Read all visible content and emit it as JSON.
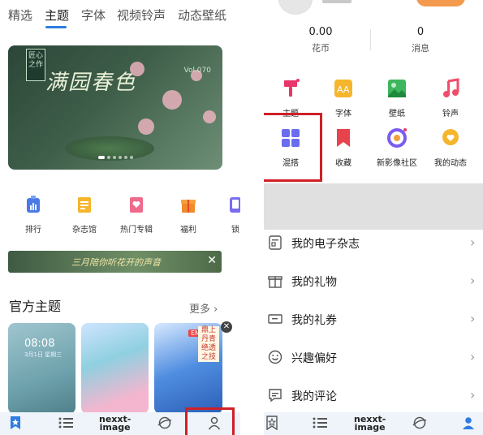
{
  "left": {
    "tabs": [
      {
        "label": "精选"
      },
      {
        "label": "主题"
      },
      {
        "label": "字体"
      },
      {
        "label": "视频铃声"
      },
      {
        "label": "动态壁纸"
      }
    ],
    "active_tab": "主题",
    "banner": {
      "title": "满园春色",
      "badge": "匠心之作",
      "vol": "Vol.070",
      "pages": 6,
      "current_page": 1
    },
    "shortcuts": [
      {
        "label": "排行",
        "icon": "ranking-icon"
      },
      {
        "label": "杂志馆",
        "icon": "magazine-icon"
      },
      {
        "label": "热门专辑",
        "icon": "album-icon"
      },
      {
        "label": "福利",
        "icon": "gift-icon"
      },
      {
        "label": "锁",
        "icon": "lock-screen-icon"
      }
    ],
    "ad_text": "三月陪你听花开的声音",
    "section_title": "官方主题",
    "section_more": "更多",
    "cards": [
      {
        "time": "08:08",
        "date": "3月1日 星期三"
      },
      {},
      {
        "tag": "EMI",
        "poem": "鼎上丹青 绝透之技"
      }
    ],
    "bottom_nav": [
      {
        "name": "home-tab",
        "icon": "star-bookmark-icon",
        "active": true
      },
      {
        "name": "category-tab",
        "icon": "list-icon"
      },
      {
        "name": "logo",
        "text_top": "nexxt-",
        "text_bottom": "image"
      },
      {
        "name": "discover-tab",
        "icon": "planet-icon"
      },
      {
        "name": "profile-tab",
        "icon": "person-icon",
        "highlighted": true
      }
    ]
  },
  "right": {
    "stats": [
      {
        "value": "0.00",
        "label": "花币"
      },
      {
        "value": "0",
        "label": "消息"
      }
    ],
    "grid": [
      {
        "label": "主题",
        "icon": "brush-icon",
        "color": "#e8366a",
        "dot": true
      },
      {
        "label": "字体",
        "icon": "font-icon",
        "color": "#f5b52c"
      },
      {
        "label": "壁纸",
        "icon": "image-icon",
        "color": "#3fb55d"
      },
      {
        "label": "铃声",
        "icon": "music-note-icon",
        "color": "#f04d6a"
      },
      {
        "label": "混搭",
        "icon": "grid-icon",
        "color": "#6b6df0",
        "highlighted": true
      },
      {
        "label": "收藏",
        "icon": "bookmark-icon",
        "color": "#e8424c"
      },
      {
        "label": "新影像社区",
        "icon": "camera-ring-icon",
        "color": "#7b5cf0",
        "dot": true
      },
      {
        "label": "我的动态",
        "icon": "heart-bubble-icon",
        "color": "#f5b52c"
      }
    ],
    "menu": [
      {
        "label": "我的电子杂志",
        "icon": "magazine-icon"
      },
      {
        "label": "我的礼物",
        "icon": "gift-icon"
      },
      {
        "label": "我的礼券",
        "icon": "coupon-icon"
      },
      {
        "label": "兴趣偏好",
        "icon": "smile-icon"
      },
      {
        "label": "我的评论",
        "icon": "comment-icon"
      }
    ],
    "bottom_nav": [
      {
        "name": "home-tab",
        "icon": "star-bookmark-icon"
      },
      {
        "name": "category-tab",
        "icon": "list-icon"
      },
      {
        "name": "logo",
        "text_top": "nexxt-",
        "text_bottom": "image"
      },
      {
        "name": "discover-tab",
        "icon": "planet-icon"
      },
      {
        "name": "profile-tab",
        "icon": "person-icon",
        "active": true
      }
    ]
  },
  "colors": {
    "accent": "#2f7de1",
    "highlight": "#cf2027",
    "nav_bg": "#eef4fa"
  }
}
